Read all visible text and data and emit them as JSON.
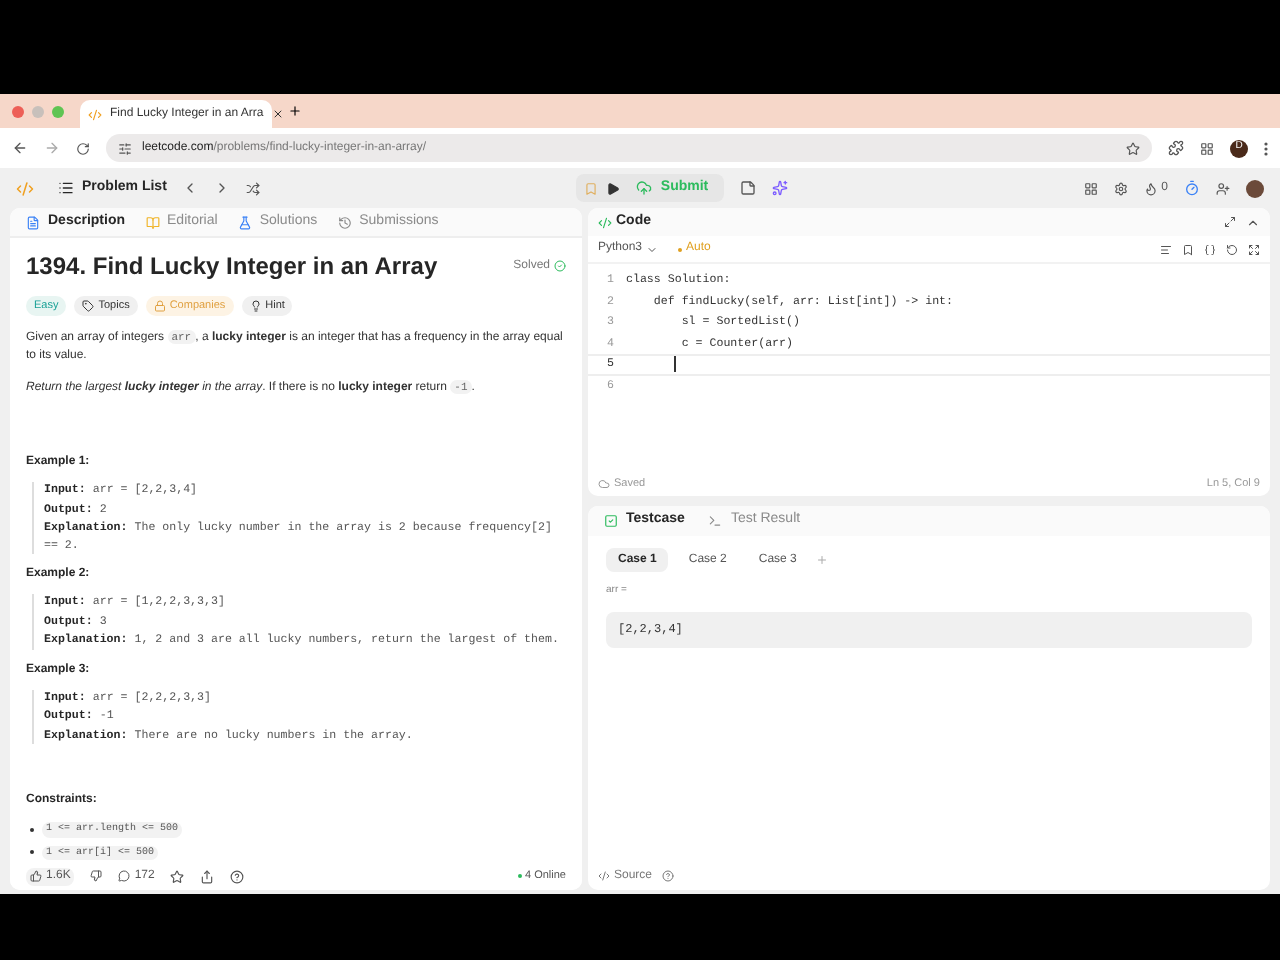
{
  "browser": {
    "tab_title": "Find Lucky Integer in an Arra",
    "url_host": "leetcode.com",
    "url_path": "/problems/find-lucky-integer-in-an-array/",
    "profile": "D"
  },
  "toolbar": {
    "problem_list": "Problem List",
    "submit": "Submit",
    "streak": "0"
  },
  "description": {
    "tabs": [
      {
        "label": "Description",
        "selected": true
      },
      {
        "label": "Editorial",
        "selected": false
      },
      {
        "label": "Solutions",
        "selected": false
      },
      {
        "label": "Submissions",
        "selected": false
      }
    ],
    "title": "1394. Find Lucky Integer in an Array",
    "status": "Solved",
    "tags": [
      {
        "label": "Easy",
        "kind": "difficulty"
      },
      {
        "label": "Topics",
        "kind": "topics"
      },
      {
        "label": "Companies",
        "kind": "companies"
      },
      {
        "label": "Hint",
        "kind": "hint"
      }
    ],
    "paragraphs": [
      [
        {
          "kind": "text",
          "text": "Given an array of integers "
        },
        {
          "kind": "code",
          "text": "arr"
        },
        {
          "kind": "text",
          "text": ", a **lucky integer** is an integer that has a frequency in the array equal to its value."
        }
      ],
      [
        {
          "kind": "text",
          "text": "*Return the largest* "
        },
        {
          "kind": "bold_italic",
          "text": "lucky integer"
        },
        {
          "kind": "text",
          "text": " *in the array*. If there is no **lucky integer** return "
        },
        {
          "kind": "code",
          "text": "-1"
        },
        {
          "kind": "text",
          "text": "."
        }
      ]
    ],
    "examples": [
      {
        "title": "Example 1:",
        "lines": [
          {
            "label": "Input:",
            "value": "arr = [2,2,3,4]"
          },
          {
            "label": "Output:",
            "value": "2"
          },
          {
            "label": "Explanation:",
            "value": "The only lucky number in the array is 2 because frequency[2] == 2."
          }
        ]
      },
      {
        "title": "Example 2:",
        "lines": [
          {
            "label": "Input:",
            "value": "arr = [1,2,2,3,3,3]"
          },
          {
            "label": "Output:",
            "value": "3"
          },
          {
            "label": "Explanation:",
            "value": "1, 2 and 3 are all lucky numbers, return the largest of them."
          }
        ]
      },
      {
        "title": "Example 3:",
        "lines": [
          {
            "label": "Input:",
            "value": "arr = [2,2,2,3,3]"
          },
          {
            "label": "Output:",
            "value": "-1"
          },
          {
            "label": "Explanation:",
            "value": "There are no lucky numbers in the array."
          }
        ]
      }
    ],
    "constraints_title": "Constraints:",
    "constraints": [
      "1 <= arr.length <= 500",
      "1 <= arr[i] <= 500"
    ],
    "footer": {
      "likes": "1.6K",
      "comments": "172",
      "online": "4 Online"
    }
  },
  "code": {
    "title": "Code",
    "language": "Python3",
    "auto": "Auto",
    "lines": [
      {
        "number": "1",
        "text": "class Solution:",
        "current": false
      },
      {
        "number": "2",
        "text": "    def findLucky(self, arr: List[int]) -> int:",
        "current": false
      },
      {
        "number": "3",
        "text": "        sl = SortedList()",
        "current": false
      },
      {
        "number": "4",
        "text": "        c = Counter(arr)",
        "current": false
      },
      {
        "number": "5",
        "current": true
      },
      {
        "number": "6",
        "current": false
      }
    ],
    "saved": "Saved",
    "position": "Ln 5, Col 9"
  },
  "testcase": {
    "tabs": [
      {
        "label": "Testcase",
        "selected": true
      },
      {
        "label": "Test Result",
        "selected": false
      }
    ],
    "cases": [
      {
        "label": "Case 1",
        "selected": true
      },
      {
        "label": "Case 2",
        "selected": false
      },
      {
        "label": "Case 3",
        "selected": false
      }
    ],
    "param": "arr =",
    "value": "[2,2,3,4]",
    "source": "Source"
  }
}
